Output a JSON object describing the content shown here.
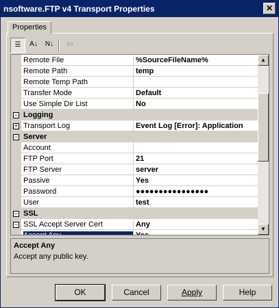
{
  "window": {
    "title": "nsoftware.FTP v4 Transport Properties",
    "close_glyph": "✕"
  },
  "tab": {
    "label": "Properties"
  },
  "toolbar": {
    "categorized_glyph": "☰",
    "alpha_glyph": "A↓",
    "sort_glyph": "N↓",
    "pages_glyph": "▭"
  },
  "grid": {
    "rows": [
      {
        "kind": "prop",
        "name": "Remote File",
        "value": "%SourceFileName%"
      },
      {
        "kind": "prop",
        "name": "Remote Path",
        "value": "temp"
      },
      {
        "kind": "prop",
        "name": "Remote Temp Path",
        "value": ""
      },
      {
        "kind": "prop",
        "name": "Transfer Mode",
        "value": "Default"
      },
      {
        "kind": "prop",
        "name": "Use Simple Dir List",
        "value": "No"
      },
      {
        "kind": "cat",
        "name": "Logging",
        "expander": "−"
      },
      {
        "kind": "prop",
        "name": "Transport Log",
        "value": "Event Log [Error]: Application",
        "expander": "+"
      },
      {
        "kind": "cat",
        "name": "Server",
        "expander": "−"
      },
      {
        "kind": "prop",
        "name": "Account",
        "value": ""
      },
      {
        "kind": "prop",
        "name": "FTP Port",
        "value": "21"
      },
      {
        "kind": "prop",
        "name": "FTP Server",
        "value": "server"
      },
      {
        "kind": "prop",
        "name": "Passive",
        "value": "Yes"
      },
      {
        "kind": "prop",
        "name": "Password",
        "value": "●●●●●●●●●●●●●●●●"
      },
      {
        "kind": "prop",
        "name": "User",
        "value": "test"
      },
      {
        "kind": "cat",
        "name": "SSL",
        "expander": "−"
      },
      {
        "kind": "prop",
        "name": "SSL Accept Server Cert",
        "value": "Any",
        "expander": "−"
      },
      {
        "kind": "sel",
        "name": "Accept Any",
        "value": "Yes"
      }
    ],
    "scroll_up": "▲",
    "scroll_down": "▼"
  },
  "description": {
    "title": "Accept Any",
    "text": "Accept any public key."
  },
  "buttons": {
    "ok": "OK",
    "cancel": "Cancel",
    "apply": "Apply",
    "help": "Help"
  }
}
